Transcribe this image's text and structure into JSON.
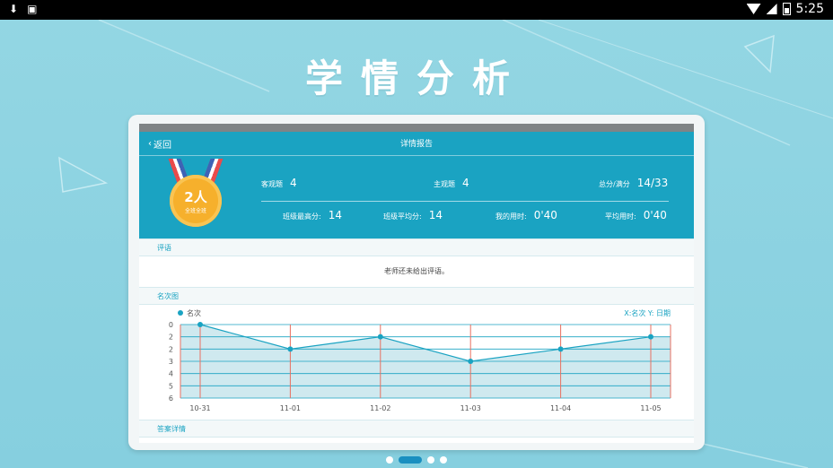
{
  "statusbar": {
    "time": "5:25"
  },
  "hero": {
    "title": "学情分析"
  },
  "app": {
    "back_label": "返回",
    "title": "详情报告",
    "medal": {
      "rank": "2人",
      "sub": "全班全班"
    },
    "stats": {
      "objective_label": "客观题",
      "objective_value": "4",
      "subjective_label": "主观题",
      "subjective_value": "4",
      "total_label": "总分/满分",
      "total_value": "14/33",
      "class_max_label": "班级最高分:",
      "class_max_value": "14",
      "class_avg_label": "班级平均分:",
      "class_avg_value": "14",
      "my_time_label": "我的用时:",
      "my_time_value": "0'40",
      "avg_time_label": "平均用时:",
      "avg_time_value": "0'40"
    },
    "comment_section": {
      "label": "评语",
      "text": "老师还未给出评语。"
    },
    "rank_section": {
      "label": "名次图"
    },
    "answer_section": {
      "label": "答案详情"
    }
  },
  "chart_data": {
    "type": "line",
    "legend": "名次",
    "axis_note": "X:名次   Y: 日期",
    "categories": [
      "10-31",
      "11-01",
      "11-02",
      "11-03",
      "11-04",
      "11-05"
    ],
    "series": [
      {
        "name": "名次",
        "values": [
          0,
          2,
          1,
          3,
          2,
          1
        ]
      }
    ],
    "y_ticks": [
      "0",
      "2",
      "2",
      "3",
      "4",
      "5",
      "6"
    ],
    "ylim": [
      0,
      6
    ],
    "colors": {
      "line": "#1aa3c2",
      "fill": "#cfe9ef",
      "vgrid": "#e87060",
      "hgrid": "#1aa3c2"
    }
  },
  "pager": {
    "count": 4,
    "active": 1
  }
}
